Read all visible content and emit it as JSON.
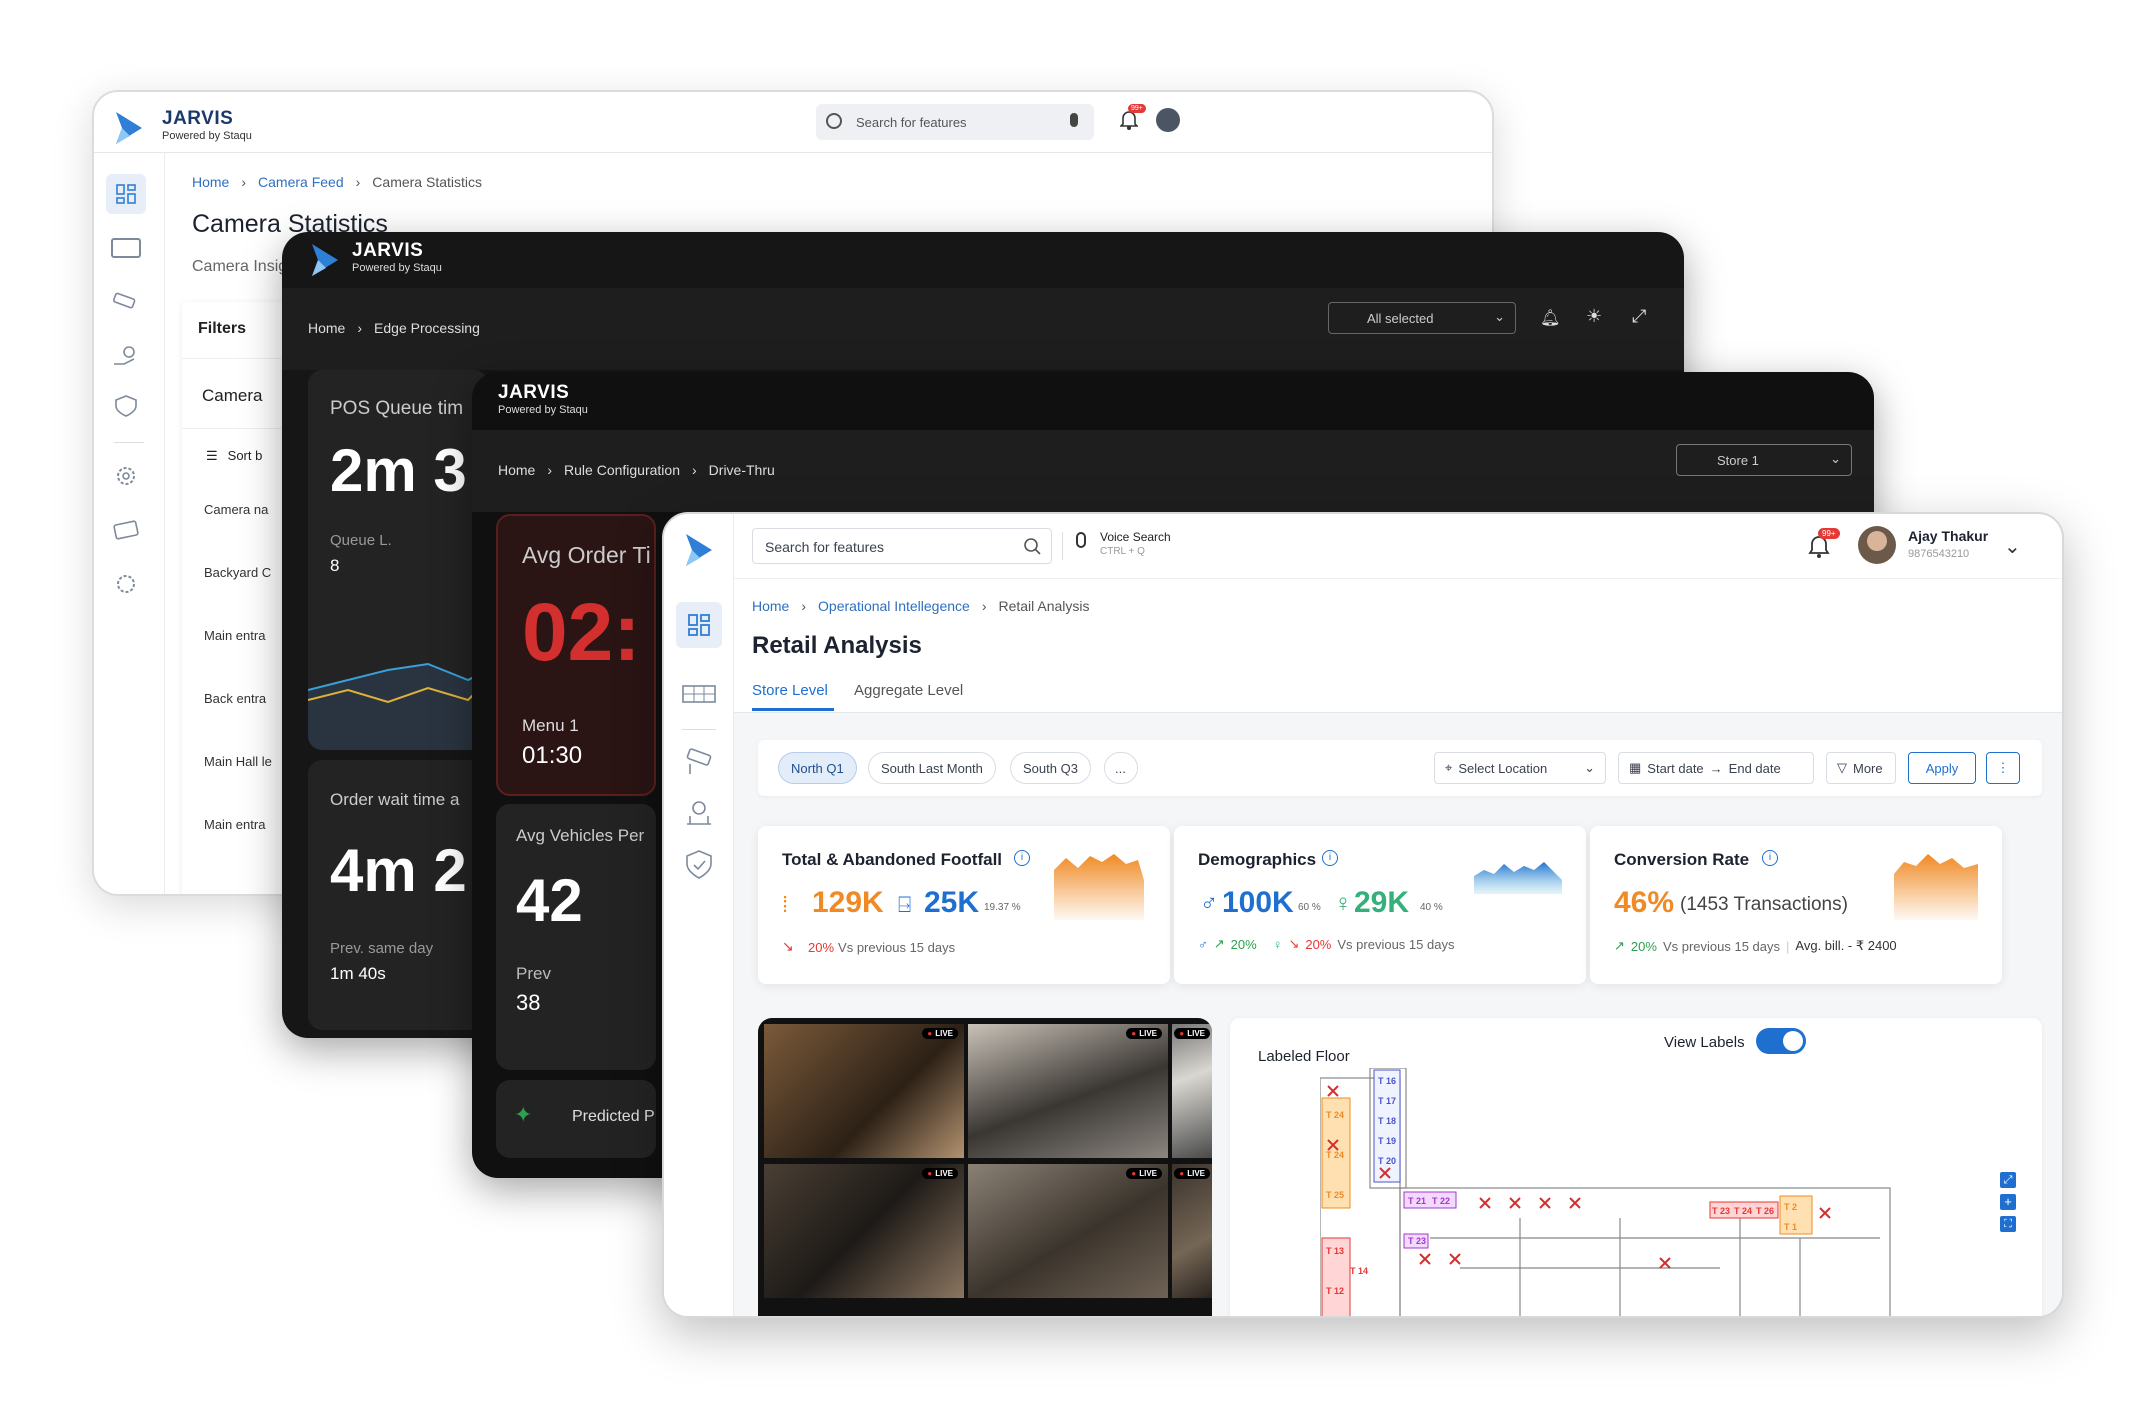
{
  "w1": {
    "brand": "JARVIS",
    "powered": "Powered by Staqu",
    "search_placeholder": "Search for features",
    "notif_badge": "99+",
    "breadcrumb": [
      "Home",
      "Camera Feed",
      "Camera Statistics"
    ],
    "title": "Camera Statistics",
    "subtitle": "Camera Insig",
    "filters": "Filters",
    "camera": "Camera",
    "sort": "Sort b",
    "rows": [
      "Camera na",
      "Backyard C",
      "Main entra",
      "Back entra",
      "Main Hall le",
      "Main entra"
    ]
  },
  "w2": {
    "brand": "JARVIS",
    "powered": "Powered by Staqu",
    "breadcrumb": [
      "Home",
      "Edge Processing"
    ],
    "select": "All selected",
    "pos_title": "POS Queue tim",
    "pos_value": "2m 3",
    "queue_label": "Queue L.",
    "queue_value": "8",
    "order_title": "Order wait time a",
    "order_value": "4m 2",
    "prev_label": "Prev. same day",
    "prev_value": "1m 40s"
  },
  "w3": {
    "brand": "JARVIS",
    "powered": "Powered by Staqu",
    "breadcrumb": [
      "Home",
      "Rule Configuration",
      "Drive-Thru"
    ],
    "store": "Store 1",
    "avg_title": "Avg Order Ti",
    "avg_value": "02:",
    "menu_label": "Menu 1",
    "menu_value": "01:30",
    "veh_title": "Avg Vehicles Per",
    "veh_value": "42",
    "veh_prev_label": "Prev",
    "veh_prev_value": "38",
    "predicted": "Predicted P"
  },
  "w4": {
    "search_placeholder": "Search for features",
    "voice_title": "Voice Search",
    "voice_shortcut": "CTRL + Q",
    "notif_badge": "99+",
    "user_name": "Ajay Thakur",
    "user_phone": "9876543210",
    "breadcrumb": [
      "Home",
      "Operational Intellegence",
      "Retail Analysis"
    ],
    "title": "Retail Analysis",
    "tabs": [
      "Store Level",
      "Aggregate Level"
    ],
    "chips": [
      "North Q1",
      "South Last Month",
      "South Q3",
      "..."
    ],
    "location": "Select Location",
    "start_date": "Start date",
    "end_date": "End date",
    "more": "More",
    "apply": "Apply",
    "footfall": {
      "title": "Total & Abandoned Footfall",
      "total": "129K",
      "abandoned": "25K",
      "abandoned_pct": "19.37 %",
      "change": "20%",
      "change_text": "Vs previous 15 days"
    },
    "demographics": {
      "title": "Demographics",
      "male": "100K",
      "male_pct": "60 %",
      "female": "29K",
      "female_pct": "40 %",
      "male_change": "20%",
      "female_change": "20%",
      "change_text": "Vs previous 15 days"
    },
    "conversion": {
      "title": "Conversion Rate",
      "value": "46%",
      "transactions": "(1453 Transactions)",
      "change": "20%",
      "change_text": "Vs previous 15 days",
      "avg_bill": "Avg. bill. - ₹ 2400"
    },
    "live": "LIVE",
    "floor_title": "Labeled Floor",
    "view_labels": "View Labels",
    "tables": [
      "T 16",
      "T 17",
      "T 18",
      "T 19",
      "T 20",
      "T 24",
      "T 24",
      "T 25",
      "T 21",
      "T 22",
      "T 23",
      "T 24",
      "T 26",
      "T 2",
      "T 1",
      "T 13",
      "T 14",
      "T 12",
      "T 23"
    ]
  },
  "colors": {
    "accent": "#1f6fd1",
    "orange": "#f08a24",
    "red": "#e53935",
    "green": "#2e9e4f",
    "dark_red": "#c62828"
  }
}
